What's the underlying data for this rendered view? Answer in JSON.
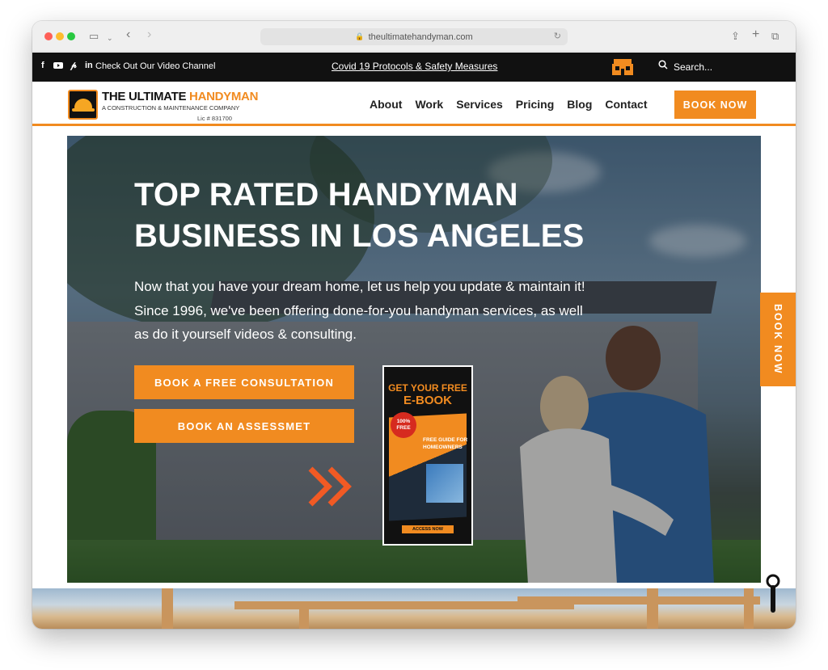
{
  "browser": {
    "url": "theultimatehandyman.com"
  },
  "topbar": {
    "social_icons": [
      "facebook-icon",
      "youtube-icon",
      "pinterest-icon",
      "linkedin-icon"
    ],
    "video_channel": "Check Out Our Video Channel",
    "covid_link": "Covid 19 Protocols & Safety Measures",
    "search_placeholder": "Search..."
  },
  "logo": {
    "title_part1": "THE ULTIMATE ",
    "title_part2": "HANDYMAN",
    "subtitle": "A CONSTRUCTION & MAINTENANCE COMPANY",
    "license": "Lic # 831700"
  },
  "nav": {
    "items": [
      {
        "label": "About"
      },
      {
        "label": "Work"
      },
      {
        "label": "Services"
      },
      {
        "label": "Pricing"
      },
      {
        "label": "Blog"
      },
      {
        "label": "Contact"
      }
    ],
    "book_now": "BOOK NOW"
  },
  "hero": {
    "title_line1": "TOP RATED HANDYMAN",
    "title_line2": "BUSINESS IN LOS ANGELES",
    "text": "Now that you have your dream home, let us help you update & maintain it! Since 1996, we've been offering done-for-you handyman services, as well as do it yourself videos & consulting.",
    "cta_consultation": "BOOK A FREE CONSULTATION",
    "cta_assessment": "BOOK AN ASSESSMET",
    "ebook": {
      "heading_line1": "GET YOUR FREE",
      "heading_line2": "E-BOOK",
      "badge": "100% FREE",
      "guide": "FREE GUIDE FOR HOMEOWNERS",
      "access": "ACCESS NOW"
    }
  },
  "side_tab": {
    "label": "BOOK NOW"
  },
  "colors": {
    "accent": "#f18b20",
    "topbar": "#111111"
  }
}
